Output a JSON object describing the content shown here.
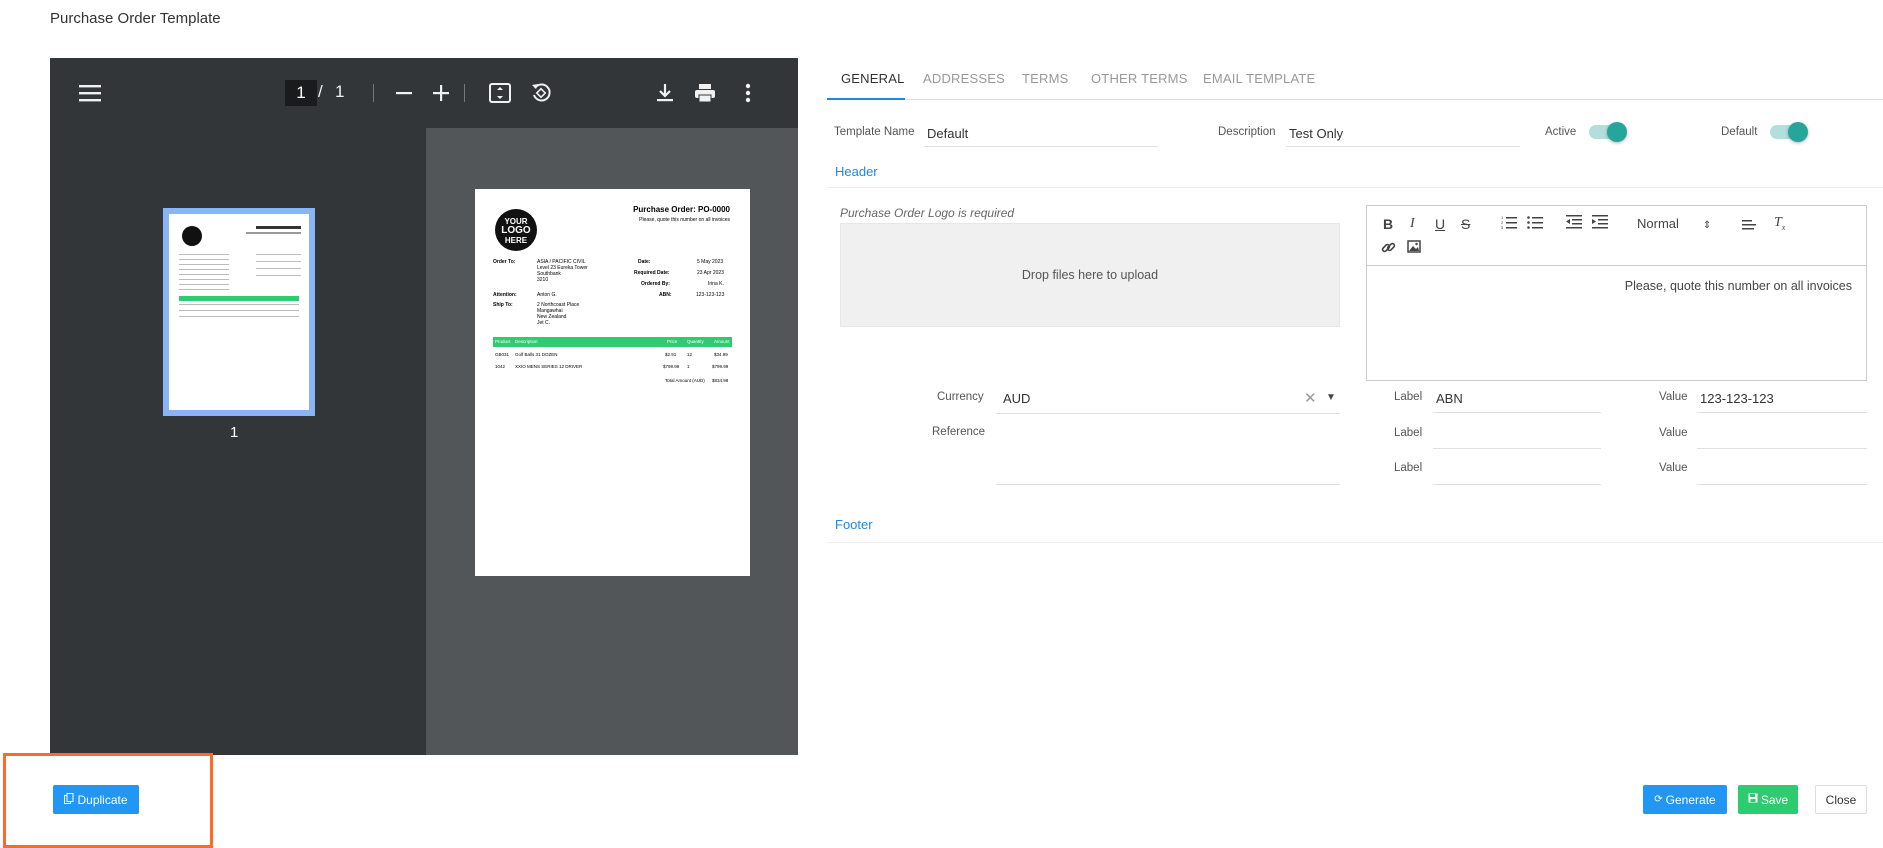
{
  "page": {
    "title": "Purchase Order Template"
  },
  "pdf_toolbar": {
    "current_page": "1",
    "separator": "/",
    "total_pages": "1"
  },
  "thumbnail": {
    "page_number": "1"
  },
  "document": {
    "logo_text": [
      "YOUR",
      "LOGO",
      "HERE"
    ],
    "title": "Purchase Order: PO-0000",
    "subtitle": "Please, quote this number on all invoices",
    "order_to_label": "Order To:",
    "order_to_value": "ASIA / PACIFIC CIVIL\nLevel 23 Eureka Tower\nSouthbank\n3210",
    "attention_label": "Attention:",
    "attention_value": "Anton G.",
    "ship_to_label": "Ship To:",
    "ship_to_value": "2 Northcoast Place\nMangawhai\nNew Zealand\nJet C.",
    "date_label": "Date:",
    "date_value": "5 May 2023",
    "required_date_label": "Required Date:",
    "required_date_value": "23 Apr 2023",
    "ordered_by_label": "Ordered By:",
    "ordered_by_value": "Irina K.",
    "abn_label": "ABN:",
    "abn_value": "123-123-123",
    "table_headers": [
      "Product",
      "Description",
      "Price",
      "Quantity",
      "Amount"
    ],
    "rows": [
      [
        "GB031",
        "Golf Balls 31 DOZEN",
        "$2.91",
        "12",
        "$34.99"
      ],
      [
        "1042",
        "XXIO MENS SERIES 12 DRIVER",
        "$799.99",
        "1",
        "$799.99"
      ]
    ],
    "total_label": "Total Amount (AUD)",
    "total_value": "$834.98"
  },
  "tabs": [
    "GENERAL",
    "ADDRESSES",
    "TERMS",
    "OTHER TERMS",
    "EMAIL TEMPLATE"
  ],
  "form": {
    "template_name_label": "Template Name",
    "template_name_value": "Default",
    "description_label": "Description",
    "description_value": "Test Only",
    "active_label": "Active",
    "active_on": true,
    "default_label": "Default",
    "default_on": true,
    "header_section": "Header",
    "logo_required": "Purchase Order Logo is required",
    "dropzone_text": "Drop files here to upload",
    "editor": {
      "format_select": "Normal",
      "content": "Please, quote this number on all invoices",
      "icons": [
        "bold-icon",
        "italic-icon",
        "underline-icon",
        "strikethrough-icon",
        "ordered-list-icon",
        "bullet-list-icon",
        "outdent-icon",
        "indent-icon",
        "align-icon",
        "clear-format-icon",
        "link-icon",
        "image-icon"
      ]
    },
    "currency_label": "Currency",
    "currency_value": "AUD",
    "reference_label": "Reference",
    "reference_value": "",
    "label_rows": [
      {
        "label": "Label",
        "label_value": "ABN",
        "value": "Value",
        "value_value": "123-123-123"
      },
      {
        "label": "Label",
        "label_value": "",
        "value": "Value",
        "value_value": ""
      },
      {
        "label": "Label",
        "label_value": "",
        "value": "Value",
        "value_value": ""
      }
    ],
    "footer_section": "Footer"
  },
  "buttons": {
    "duplicate": "Duplicate",
    "generate": "Generate",
    "save": "Save",
    "close": "Close"
  },
  "colors": {
    "primary": "#2196f3",
    "success": "#2ecc71",
    "toggle": "#26a69a",
    "highlight": "#ff6a2a"
  }
}
